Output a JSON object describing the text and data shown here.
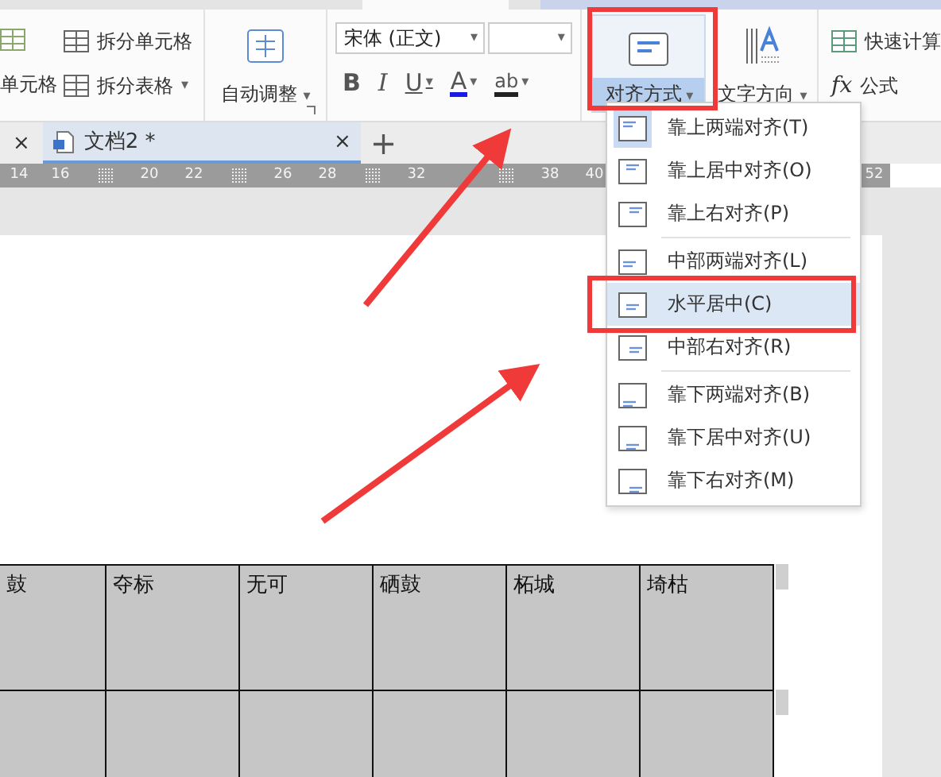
{
  "ribbon": {
    "merge": {
      "label": "单元格"
    },
    "split_cells": {
      "label": "拆分单元格"
    },
    "split_table": {
      "label": "拆分表格",
      "caret": "▾"
    },
    "autofit": {
      "label": "自动调整",
      "caret": "▾"
    },
    "font": {
      "name": "宋体 (正文)",
      "caret": "▾"
    },
    "font_size": {
      "caret": "▾"
    },
    "format": [
      {
        "label": "B",
        "kind": "bold"
      },
      {
        "label": "I",
        "kind": "italic"
      },
      {
        "label": "U",
        "kind": "underline",
        "caret": "▾"
      },
      {
        "label": "A",
        "kind": "color",
        "caret": "▾"
      },
      {
        "label": "ab",
        "kind": "highlight",
        "caret": "▾"
      }
    ],
    "align": {
      "label": "对齐方式",
      "caret": "▾",
      "expanded": true
    },
    "direction": {
      "label": "文字方向",
      "caret": "▾"
    },
    "quick_calc": {
      "label": "快速计算"
    },
    "formula": {
      "symbol": "fx",
      "label": "公式"
    }
  },
  "tab_bar": {
    "prev_close": "×",
    "add": "+"
  },
  "doc_tabs": [
    {
      "title": "文档2 *",
      "close": "×",
      "selected": true
    }
  ],
  "ruler": [
    {
      "kind": "number",
      "label": "14"
    },
    {
      "kind": "number",
      "label": "16"
    },
    {
      "kind": "marker"
    },
    {
      "kind": "number",
      "label": "20"
    },
    {
      "kind": "number",
      "label": "22"
    },
    {
      "kind": "marker"
    },
    {
      "kind": "number",
      "label": "26"
    },
    {
      "kind": "number",
      "label": "28"
    },
    {
      "kind": "marker"
    },
    {
      "kind": "number",
      "label": "32"
    },
    {
      "kind": "gap"
    },
    {
      "kind": "marker"
    },
    {
      "kind": "number",
      "label": "38"
    },
    {
      "kind": "number",
      "label": "40"
    }
  ],
  "ruler_end": "52",
  "table": {
    "rows": [
      [
        "鼓",
        "夺标",
        "无可",
        "硒鼓",
        "柘城",
        "埼枯"
      ],
      [
        "",
        "",
        "",
        "",
        "",
        ""
      ]
    ]
  },
  "align_menu": [
    [
      {
        "label": "靠上两端对齐(T)",
        "checked": true,
        "selected": false
      },
      {
        "label": "靠上居中对齐(O)",
        "checked": false,
        "selected": false
      },
      {
        "label": "靠上右对齐(P)",
        "checked": false,
        "selected": false
      }
    ],
    [
      {
        "label": "中部两端对齐(L)",
        "checked": false,
        "selected": false
      },
      {
        "label": "水平居中(C)",
        "checked": false,
        "selected": true
      },
      {
        "label": "中部右对齐(R)",
        "checked": false,
        "selected": false
      }
    ],
    [
      {
        "label": "靠下两端对齐(B)",
        "checked": false,
        "selected": false
      },
      {
        "label": "靠下居中对齐(U)",
        "checked": false,
        "selected": false
      },
      {
        "label": "靠下右对齐(M)",
        "checked": false,
        "selected": false
      }
    ]
  ]
}
